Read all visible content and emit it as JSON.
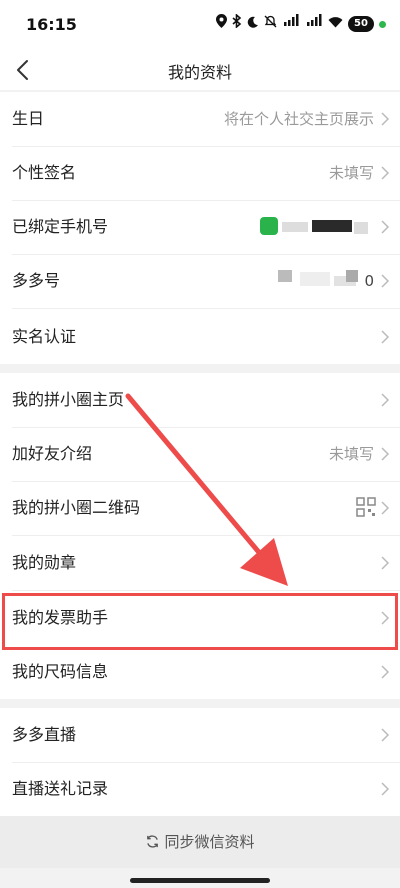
{
  "status": {
    "time": "16:15",
    "battery": "50"
  },
  "nav": {
    "title": "我的资料"
  },
  "section1": [
    {
      "label": "生日",
      "value": "将在个人社交主页展示"
    },
    {
      "label": "个性签名",
      "value": "未填写"
    },
    {
      "label": "已绑定手机号",
      "value": ""
    },
    {
      "label": "多多号",
      "value": "0"
    },
    {
      "label": "实名认证",
      "value": ""
    }
  ],
  "section2": [
    {
      "label": "我的拼小圈主页",
      "value": ""
    },
    {
      "label": "加好友介绍",
      "value": "未填写"
    },
    {
      "label": "我的拼小圈二维码",
      "value": ""
    },
    {
      "label": "我的勋章",
      "value": ""
    },
    {
      "label": "我的发票助手",
      "value": ""
    },
    {
      "label": "我的尺码信息",
      "value": ""
    }
  ],
  "section3": [
    {
      "label": "多多直播",
      "value": ""
    },
    {
      "label": "直播送礼记录",
      "value": ""
    }
  ],
  "footer": {
    "sync_label": "同步微信资料"
  },
  "colors": {
    "highlight": "#ee4b4b",
    "accent_green": "#2ab34b"
  }
}
